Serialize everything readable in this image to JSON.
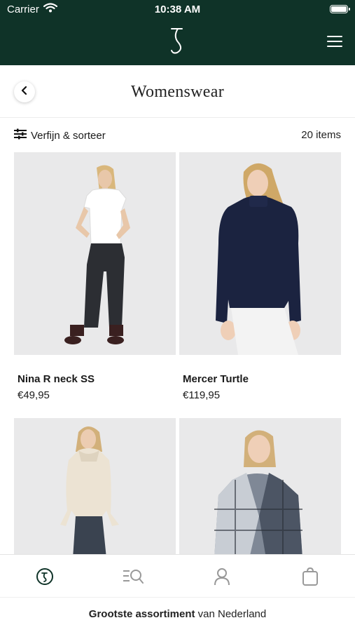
{
  "status_bar": {
    "carrier": "Carrier",
    "time": "10:38 AM"
  },
  "header": {
    "logo_icon": "brand-j-logo",
    "menu_icon": "hamburger-menu-icon"
  },
  "titlebar": {
    "title": "Womenswear",
    "back_icon": "chevron-left-icon"
  },
  "filter": {
    "label": "Verfijn & sorteer",
    "icon": "sliders-icon",
    "count": "20 items"
  },
  "products": [
    {
      "name": "Nina R neck SS",
      "price": "€49,95"
    },
    {
      "name": "Mercer Turtle",
      "price": "€119,95"
    },
    {
      "name": "",
      "price": ""
    },
    {
      "name": "",
      "price": ""
    }
  ],
  "tabbar": {
    "tabs": [
      "home-logo-icon",
      "search-list-icon",
      "account-icon",
      "bag-icon"
    ]
  },
  "footer": {
    "bold": "Grootste assortiment",
    "rest": " van Nederland"
  },
  "colors": {
    "brand": "#0f3328",
    "background": "#ffffff",
    "photo_bg": "#e9e9ea"
  }
}
